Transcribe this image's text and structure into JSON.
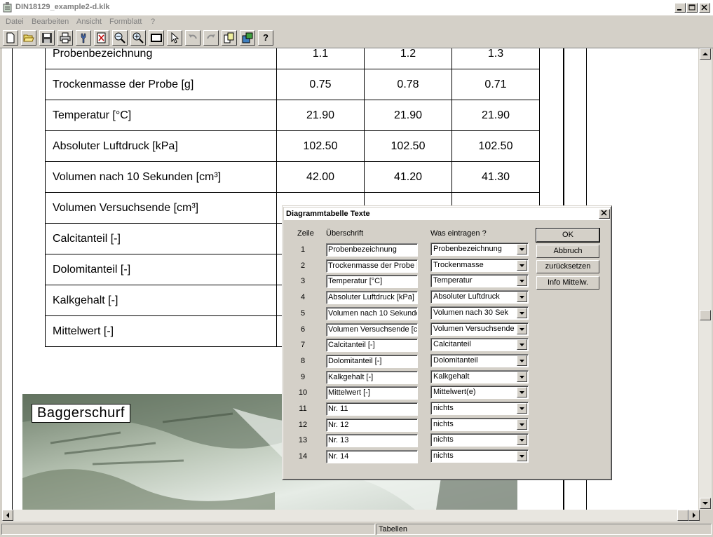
{
  "window": {
    "title": "DIN18129_example2-d.klk"
  },
  "menu": [
    "Datei",
    "Bearbeiten",
    "Ansicht",
    "Formblatt",
    "?"
  ],
  "toolbar": {
    "help_label": "?"
  },
  "table": {
    "rows": [
      {
        "label": "Probenbezeichnung",
        "values": [
          "1.1",
          "1.2",
          "1.3"
        ]
      },
      {
        "label": "Trockenmasse der Probe [g]",
        "values": [
          "0.75",
          "0.78",
          "0.71"
        ]
      },
      {
        "label": "Temperatur [°C]",
        "values": [
          "21.90",
          "21.90",
          "21.90"
        ]
      },
      {
        "label": "Absoluter Luftdruck [kPa]",
        "values": [
          "102.50",
          "102.50",
          "102.50"
        ]
      },
      {
        "label": "Volumen nach 10 Sekunden [cm³]",
        "values": [
          "42.00",
          "41.20",
          "41.30"
        ]
      },
      {
        "label": "Volumen Versuchsende [cm³]",
        "values": [
          "",
          "",
          ""
        ]
      },
      {
        "label": "Calcitanteil [-]",
        "values": [
          "",
          "",
          ""
        ]
      },
      {
        "label": "Dolomitanteil [-]",
        "values": [
          "",
          "",
          ""
        ]
      },
      {
        "label": "Kalkgehalt [-]",
        "values": [
          "",
          "",
          ""
        ]
      },
      {
        "label": "Mittelwert [-]",
        "values": [
          "",
          "",
          ""
        ]
      }
    ]
  },
  "photo": {
    "caption": "Baggerschurf"
  },
  "dialog": {
    "title": "Diagrammtabelle Texte",
    "col_zeile": "Zeile",
    "col_ueberschrift": "Überschrift",
    "col_was": "Was eintragen ?",
    "rows": [
      {
        "n": "1",
        "text": "Probenbezeichnung",
        "select": "Probenbezeichnung"
      },
      {
        "n": "2",
        "text": "Trockenmasse der Probe [",
        "select": "Trockenmasse"
      },
      {
        "n": "3",
        "text": "Temperatur [°C]",
        "select": "Temperatur"
      },
      {
        "n": "4",
        "text": "Absoluter Luftdruck [kPa]",
        "select": "Absoluter Luftdruck"
      },
      {
        "n": "5",
        "text": "Volumen nach 10 Sekunde",
        "select": "Volumen nach 30 Sek"
      },
      {
        "n": "6",
        "text": "Volumen Versuchsende [cr",
        "select": "Volumen Versuchsende"
      },
      {
        "n": "7",
        "text": "Calcitanteil [-]",
        "select": "Calcitanteil"
      },
      {
        "n": "8",
        "text": "Dolomitanteil [-]",
        "select": "Dolomitanteil"
      },
      {
        "n": "9",
        "text": "Kalkgehalt [-]",
        "select": "Kalkgehalt"
      },
      {
        "n": "10",
        "text": "Mittelwert [-]",
        "select": "Mittelwert(e)"
      },
      {
        "n": "11",
        "text": "Nr. 11",
        "select": "nichts"
      },
      {
        "n": "12",
        "text": "Nr. 12",
        "select": "nichts"
      },
      {
        "n": "13",
        "text": "Nr. 13",
        "select": "nichts"
      },
      {
        "n": "14",
        "text": "Nr. 14",
        "select": "nichts"
      }
    ],
    "buttons": {
      "ok": "OK",
      "cancel": "Abbruch",
      "reset": "zurücksetzen",
      "info": "Info Mittelw."
    }
  },
  "status": {
    "center": "Tabellen"
  }
}
